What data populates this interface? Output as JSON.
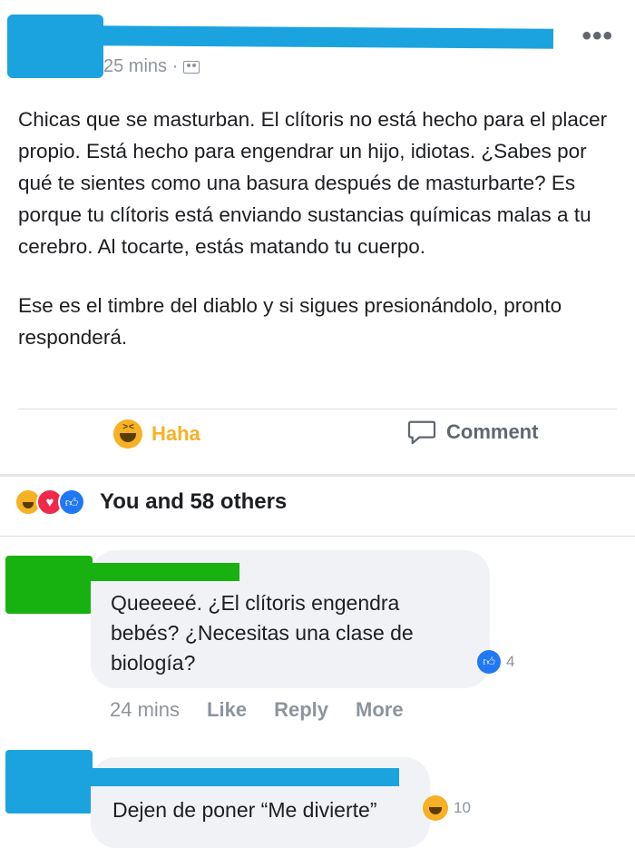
{
  "post": {
    "time": "25 mins ·",
    "more": "•••",
    "body_paragraph_1": "Chicas que se masturban. El clítoris no está hecho para el placer propio. Está hecho para engendrar un hijo, idiotas. ¿Sabes por qué te sientes como una basura después de masturbarte? Es porque tu clítoris está enviando sustancias químicas malas a tu cerebro. Al tocarte, estás matando tu cuerpo.",
    "body_paragraph_2": "Ese es el timbre del diablo y si sigues presionándolo, pronto responderá.",
    "actions": {
      "haha": "Haha",
      "comment": "Comment"
    },
    "reactions": {
      "summary": "You and 58 others"
    }
  },
  "comments": [
    {
      "text": "Queeeeé. ¿El clítoris engendra bebés? ¿Necesitas una clase de biología?",
      "like_count": "4",
      "time": "24 mins",
      "like_label": "Like",
      "reply_label": "Reply",
      "more_label": "More"
    },
    {
      "text": "Dejen de poner “Me divierte”",
      "haha_count": "10"
    }
  ],
  "colors": {
    "redaction_cyan": "#1ba3e0",
    "redaction_green": "#17b20f",
    "haha_yellow": "#f7b125",
    "like_blue": "#2078f4",
    "love_red": "#f0284a"
  }
}
